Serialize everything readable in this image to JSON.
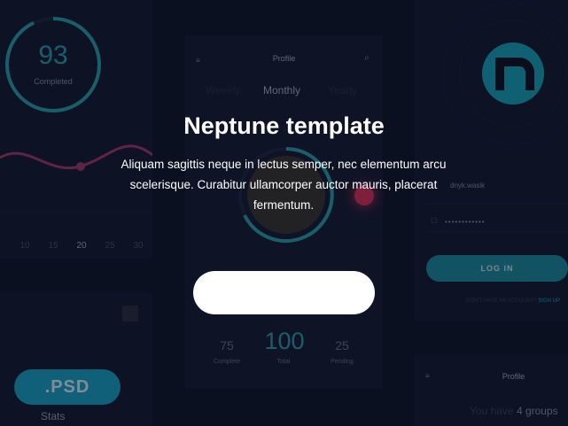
{
  "hero": {
    "title": "Neptune template",
    "description": "Aliquam sagittis neque in lectus semper, nec elementum arcu scelerisque. Curabitur ullamcorper auctor mauris, placerat fermentum.",
    "cta_label": ""
  },
  "left_card": {
    "gauge_value": "93",
    "gauge_label": "Completed",
    "gauge_progress": 0.93,
    "ticks": [
      "10",
      "15",
      "20",
      "25",
      "30"
    ],
    "active_tick": "20"
  },
  "left_bottom": {
    "psd_label": ".PSD",
    "stats_label": "Stats"
  },
  "middle_card": {
    "title": "Profile",
    "tabs": [
      "Weekly",
      "Monthly",
      "Yearly"
    ],
    "active_tab": "Monthly",
    "stats": [
      {
        "value": "75",
        "label": "Complete"
      },
      {
        "value": "100",
        "label": "Total"
      },
      {
        "value": "25",
        "label": "Pending"
      }
    ]
  },
  "right_card": {
    "username": "dnyk.wasik",
    "password": "••••••••••••",
    "login_label": "LOG IN",
    "signup_text": "DON'T HAVE AN ACCOUNT?",
    "signup_link": "SIGN UP"
  },
  "right_bottom": {
    "title": "Profile",
    "groups_text": "You have",
    "groups_count": "4 groups"
  },
  "colors": {
    "accent": "#1ba6c9",
    "chart_line": "#a83a6a",
    "notify": "#e0305a",
    "background": "#0e1426"
  }
}
